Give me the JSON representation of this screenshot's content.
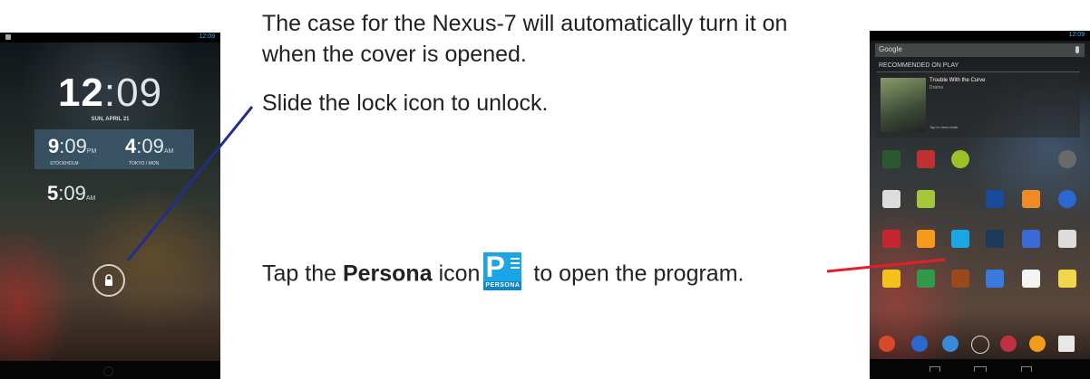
{
  "captions": {
    "open_cover": "The case for the Nexus-7 will automatically turn it on when the cover is opened.",
    "unlock": "Slide the lock icon to unlock.",
    "tap_prefix": "Tap the ",
    "tap_bold": "Persona",
    "tap_middle": " icon",
    "tap_suffix": " to open the program."
  },
  "persona_icon": {
    "letter": "P",
    "word": "PERSONA"
  },
  "lock_screen": {
    "main_hour": "12",
    "main_min": ":09",
    "date": "SUN, APRIL 21",
    "world_clocks": [
      {
        "hour": "9",
        "min": ":09",
        "ampm": "PM",
        "city": "STOCKHOLM"
      },
      {
        "hour": "4",
        "min": ":09",
        "ampm": "AM",
        "city": "TOKYO / MON"
      },
      {
        "hour": "5",
        "min": ":09",
        "ampm": "AM"
      }
    ],
    "status_time": "12:09"
  },
  "home_screen": {
    "status_time": "12:09",
    "search_label": "Google",
    "recommended_header": "RECOMMENDED ON PLAY",
    "rec_title": "Trouble With the Curve",
    "rec_sub": "Drama",
    "rec_tap": "Tap to view rental"
  },
  "colors": {
    "unlock_line": "#1f2f8a",
    "persona_line": "#e0202a",
    "persona_blue": "#1aa5e5",
    "accent_blue": "#33b5e5"
  }
}
